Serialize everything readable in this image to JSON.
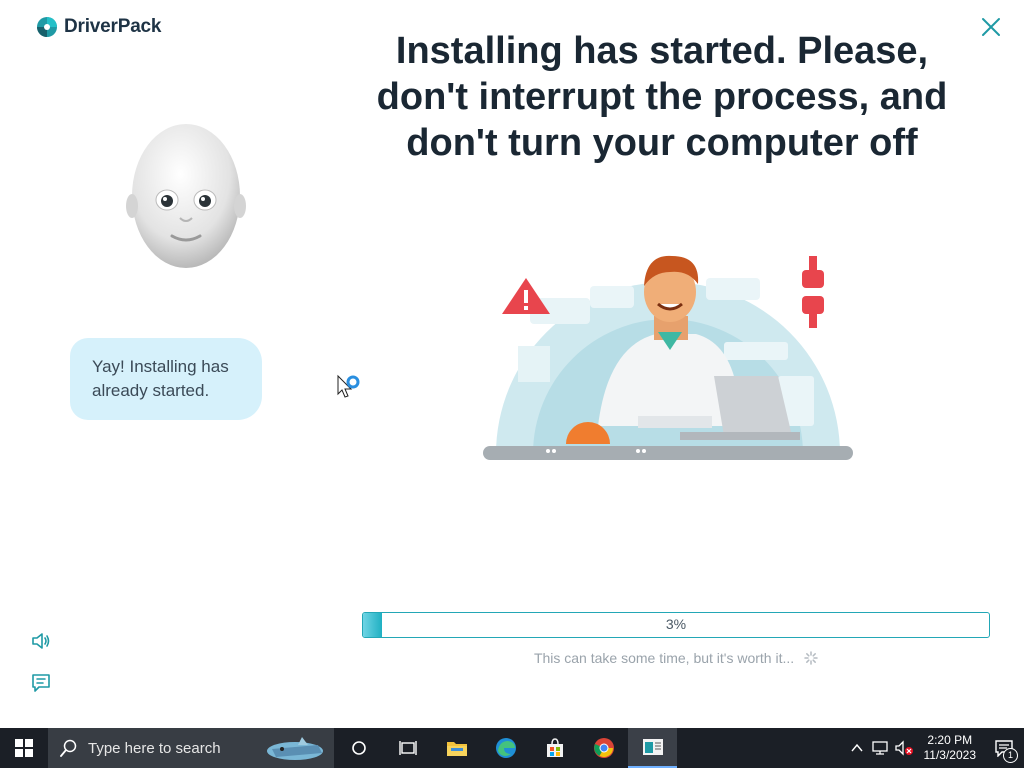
{
  "app": {
    "brand": "DriverPack",
    "headline": "Installing has started. Please, don't interrupt the process, and don't turn your computer off",
    "bubble_text": "Yay! Installing has already started.",
    "progress_percent": 3,
    "progress_label": "3%",
    "hint": "This can take some time, but it's worth it...",
    "accent_color": "#23a7b6",
    "icons": [
      "driverpack-logo-icon",
      "close-icon",
      "speaker-icon",
      "chat-icon",
      "loading-spinner-icon"
    ]
  },
  "taskbar": {
    "search_placeholder": "Type here to search",
    "apps": [
      "cortana-icon",
      "task-view-icon",
      "file-explorer-icon",
      "edge-icon",
      "store-icon",
      "chrome-icon",
      "driverpack-taskbar-icon"
    ],
    "time": "2:20 PM",
    "date": "11/3/2023",
    "notification_count": "1"
  }
}
